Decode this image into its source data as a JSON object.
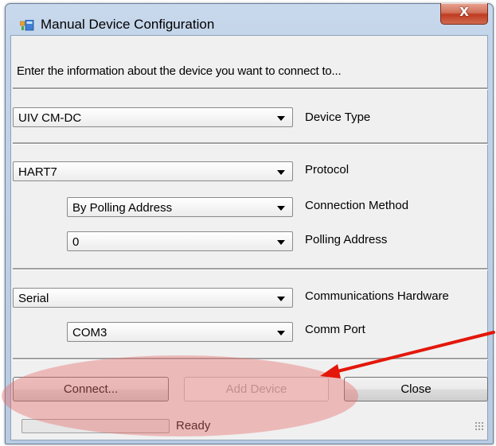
{
  "window": {
    "title": "Manual Device Configuration",
    "close_glyph": "X"
  },
  "instruction": "Enter the information about the device you want to connect to...",
  "device_type": {
    "value": "UIV CM-DC",
    "label": "Device Type"
  },
  "protocol": {
    "value": "HART7",
    "label": "Protocol"
  },
  "connection_method": {
    "value": "By Polling Address",
    "label": "Connection Method"
  },
  "polling_address": {
    "value": "0",
    "label": "Polling Address"
  },
  "communications_hardware": {
    "value": "Serial",
    "label": "Communications Hardware"
  },
  "comm_port": {
    "value": "COM3",
    "label": "Comm Port"
  },
  "buttons": {
    "connect": "Connect...",
    "add_device": "Add Device",
    "close": "Close"
  },
  "status": {
    "text": "Ready",
    "progress": 0
  },
  "annotation": {
    "highlight_color": "#e86e6e",
    "arrow_color": "#e3170a"
  }
}
